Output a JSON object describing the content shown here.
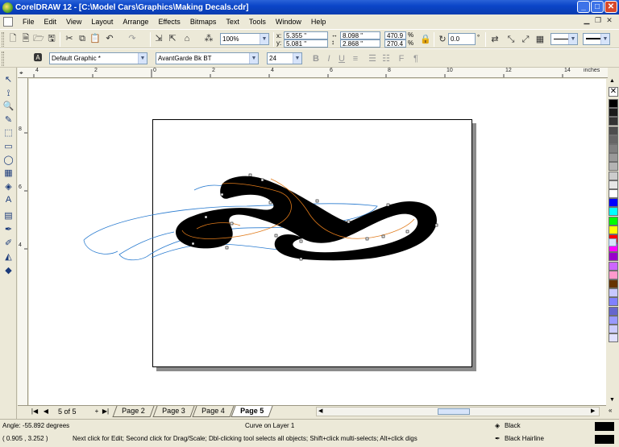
{
  "window": {
    "title": "CorelDRAW 12 - [C:\\Model Cars\\Graphics\\Making Decals.cdr]",
    "minimize_glyph": "_",
    "maximize_glyph": "□",
    "close_glyph": "✕"
  },
  "menu": [
    "File",
    "Edit",
    "View",
    "Layout",
    "Arrange",
    "Effects",
    "Bitmaps",
    "Text",
    "Tools",
    "Window",
    "Help"
  ],
  "toolbar1": {
    "zoom": "100%",
    "x": "5.355 \"",
    "y": "5.081 \"",
    "x_label": "x:",
    "y_label": "y:",
    "width": "8.098 \"",
    "height": "2.868 \"",
    "scale_x": "470.9",
    "scale_y": "270.4",
    "percent": "%",
    "rotation": "0.0",
    "degree": "°"
  },
  "toolbar2": {
    "style": "Default Graphic *",
    "font": "AvantGarde Bk BT",
    "font_size": "24"
  },
  "ruler": {
    "unit": "inches",
    "h_ticks": [
      "4",
      "2",
      "0",
      "2",
      "4",
      "6",
      "8",
      "10",
      "12",
      "14"
    ],
    "v_ticks": [
      "8",
      "6",
      "4"
    ],
    "v_unit": "inches"
  },
  "palette_colors": [
    "#000000",
    "#1a1a1a",
    "#333333",
    "#4d4d4d",
    "#666666",
    "#808080",
    "#999999",
    "#b3b3b3",
    "#cccccc",
    "#e6e6e6",
    "#ffffff",
    "#0000ff",
    "#00ffff",
    "#00ff00",
    "#ffff00",
    "#ff0000",
    "#ff00ff",
    "#9900cc",
    "#cc66ff",
    "#ff99cc",
    "#663300",
    "#c8c8ff",
    "#8080ff",
    "#6666cc",
    "#9999ff",
    "#ccccff",
    "#e0e0ff"
  ],
  "pages": {
    "counter": "5 of 5",
    "tabs": [
      "Page 2",
      "Page 3",
      "Page 4",
      "Page 5"
    ],
    "active": "Page 5"
  },
  "status": {
    "angle": "Angle: -55.892 degrees",
    "object": "Curve on Layer 1",
    "fill_label": "Black",
    "outline_label": "Black  Hairline",
    "coords": "( 0.905 , 3.252 )",
    "hint": "Next click for Edit; Second click for Drag/Scale; Dbl-clicking tool selects all objects; Shift+click multi-selects; Alt+click digs"
  }
}
